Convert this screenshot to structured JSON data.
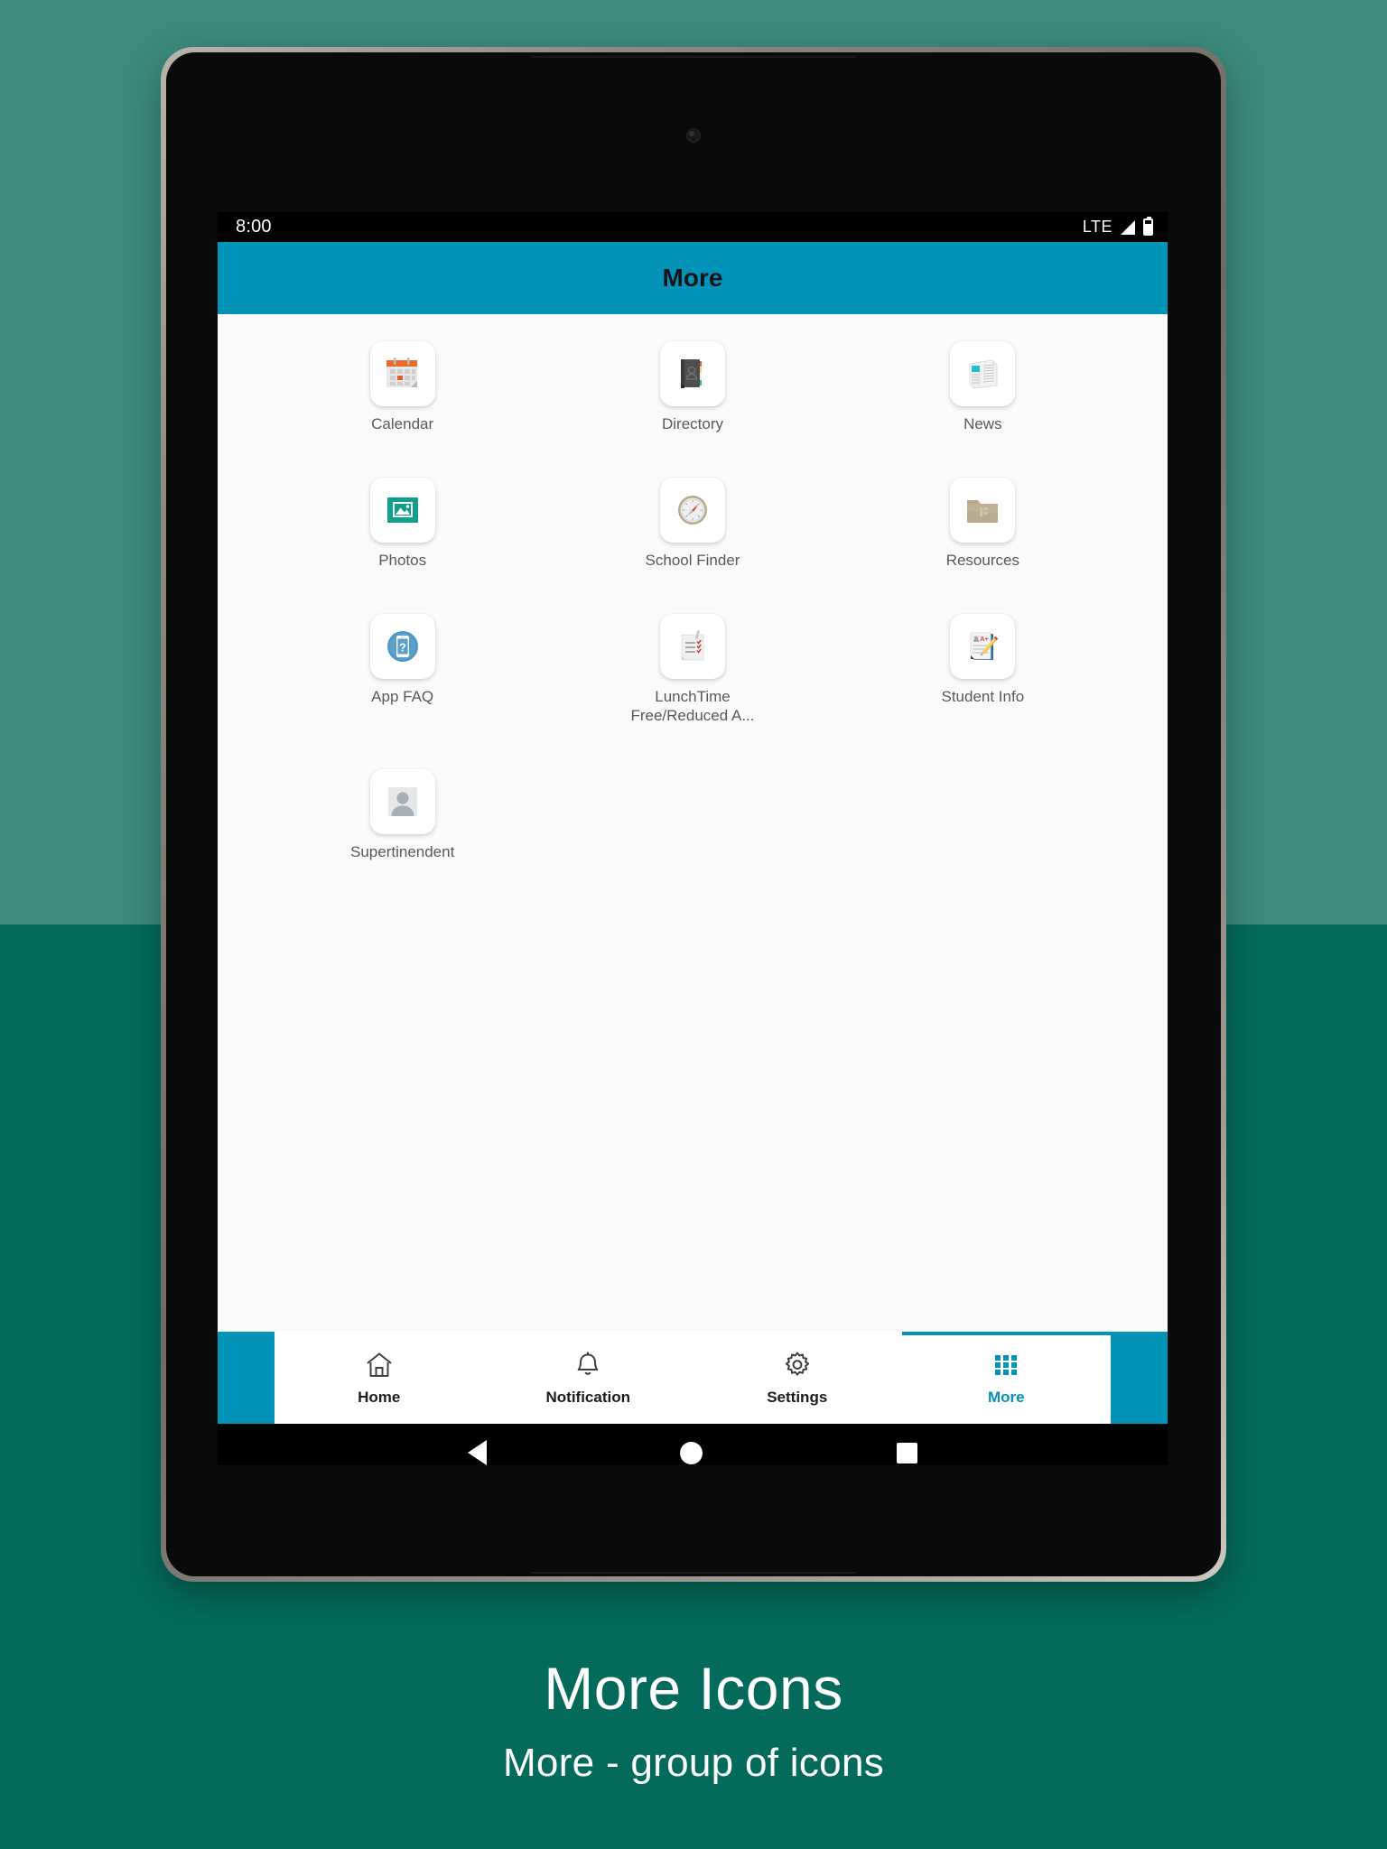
{
  "status_bar": {
    "clock": "8:00",
    "network": "LTE",
    "signal_icon": "signal-bars-icon",
    "battery_icon": "battery-icon"
  },
  "app_bar": {
    "title": "More"
  },
  "grid": {
    "items": [
      {
        "label": "Calendar",
        "icon": "calendar-icon"
      },
      {
        "label": "Directory",
        "icon": "address-book-icon"
      },
      {
        "label": "News",
        "icon": "newspaper-icon"
      },
      {
        "label": "Photos",
        "icon": "photo-icon"
      },
      {
        "label": "School Finder",
        "icon": "compass-icon"
      },
      {
        "label": "Resources",
        "icon": "folder-icon"
      },
      {
        "label": "App FAQ",
        "icon": "phone-question-icon"
      },
      {
        "label": "LunchTime\nFree/Reduced A...",
        "icon": "checklist-icon"
      },
      {
        "label": "Student Info",
        "icon": "report-card-icon"
      },
      {
        "label": "Supertinendent",
        "icon": "person-avatar-icon"
      }
    ]
  },
  "bottom_nav": {
    "items": [
      {
        "label": "Home",
        "icon": "house-icon",
        "active": false
      },
      {
        "label": "Notification",
        "icon": "bell-icon",
        "active": false
      },
      {
        "label": "Settings",
        "icon": "gear-icon",
        "active": false
      },
      {
        "label": "More",
        "icon": "grid-icon",
        "active": true
      }
    ]
  },
  "android_keys": {
    "back": "back-triangle-icon",
    "home": "home-circle-icon",
    "recent": "recent-square-icon"
  },
  "caption": {
    "title": "More Icons",
    "subtitle": "More - group of icons"
  },
  "colors": {
    "accent": "#0392b8",
    "background_top": "#3c8b7c",
    "background_bottom": "#046a5c",
    "screen": "#fafafa",
    "label_text": "#565a5e"
  }
}
